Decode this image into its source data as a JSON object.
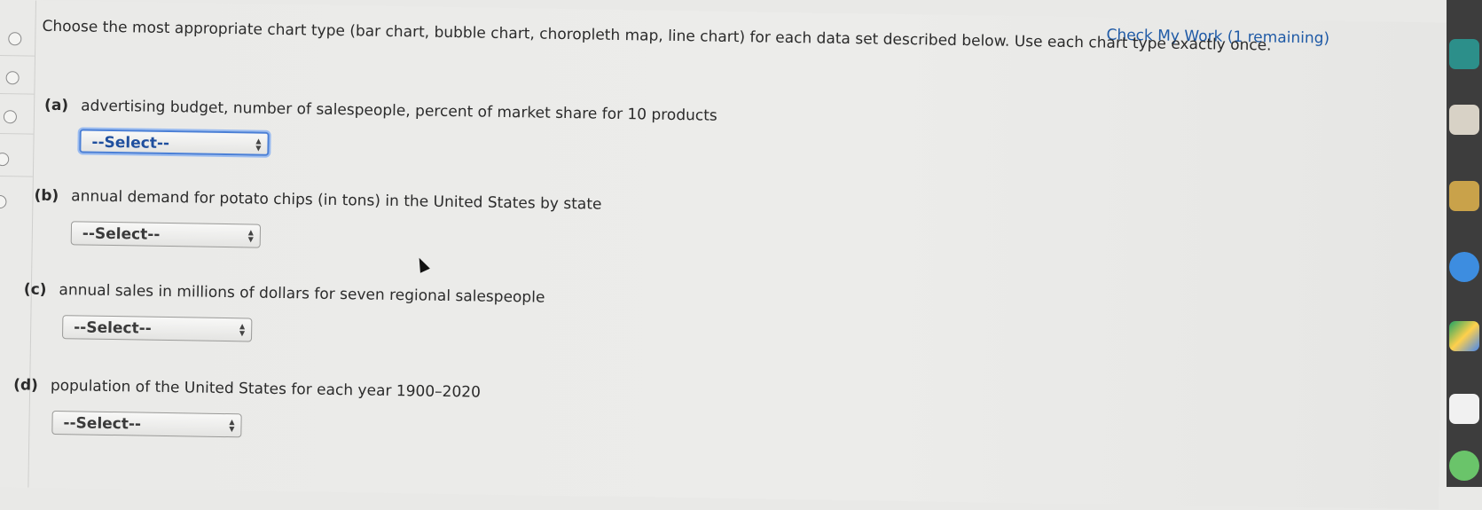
{
  "header": {
    "check_work": "Check My Work (1 remaining)"
  },
  "instructions": "Choose the most appropriate chart type (bar chart, bubble chart, choropleth map, line chart) for each data set described below. Use each chart type exactly once.",
  "questions": [
    {
      "label": "(a)",
      "text": "advertising budget, number of salespeople, percent of market share for 10 products",
      "select_value": "--Select--"
    },
    {
      "label": "(b)",
      "text": "annual demand for potato chips (in tons) in the United States by state",
      "select_value": "--Select--"
    },
    {
      "label": "(c)",
      "text": "annual sales in millions of dollars for seven regional salespeople",
      "select_value": "--Select--"
    },
    {
      "label": "(d)",
      "text": "population of the United States for each year 1900–2020",
      "select_value": "--Select--"
    }
  ],
  "colors": {
    "link": "#1f5aa6",
    "focus": "#4a7fd6",
    "background": "#e9e9e7"
  }
}
